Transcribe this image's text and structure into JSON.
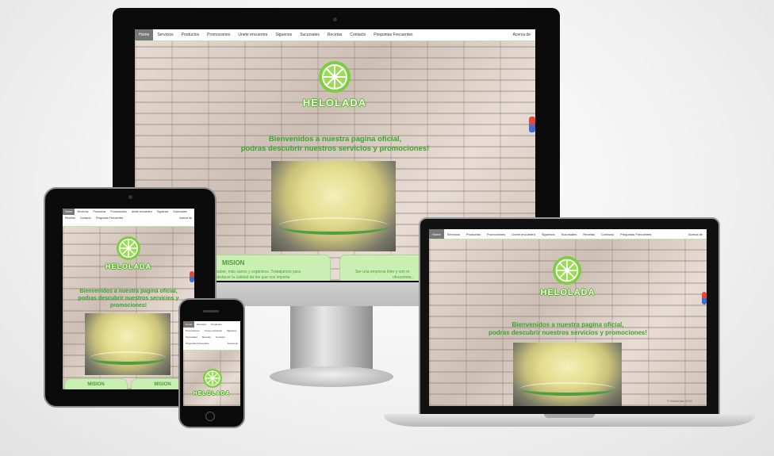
{
  "nav": {
    "items": [
      "Home",
      "Servicios",
      "Productos",
      "Promociones",
      "Unete encuentra",
      "Siguenos",
      "Sucursales",
      "Recetas",
      "Contacto",
      "Preguntas Frecuentes"
    ],
    "right": "Acerca de"
  },
  "mobile_nav": {
    "items": [
      "Home",
      "Servicios",
      "Productos",
      "Promociones",
      "Unete encuentra",
      "Siguenos",
      "Sucursales",
      "Recetas",
      "Contacto",
      "Preguntas Frecuentes"
    ],
    "right": "Acerca de"
  },
  "brand": {
    "name": "HELOLADA"
  },
  "hero": {
    "line1": "Bienvenidos a nuestra pagina oficial,",
    "line2": "podras descubrir nuestros servicios y promociones!"
  },
  "mission": {
    "title": "MISION",
    "text_line1": "te sabor, más sanos y orgánicos. Trabajamos para",
    "text_line2": "sastisfacer la calidad de los que nos importa"
  },
  "vision": {
    "text_line1": "Ser una empresa líder y con m",
    "text_line2": "ofrecemos..."
  },
  "laptop_footer": "© Heloladas 2015",
  "colors": {
    "accent": "#7ccf3c",
    "text_green": "#3aa62e",
    "card_bg": "#c9efb4"
  }
}
